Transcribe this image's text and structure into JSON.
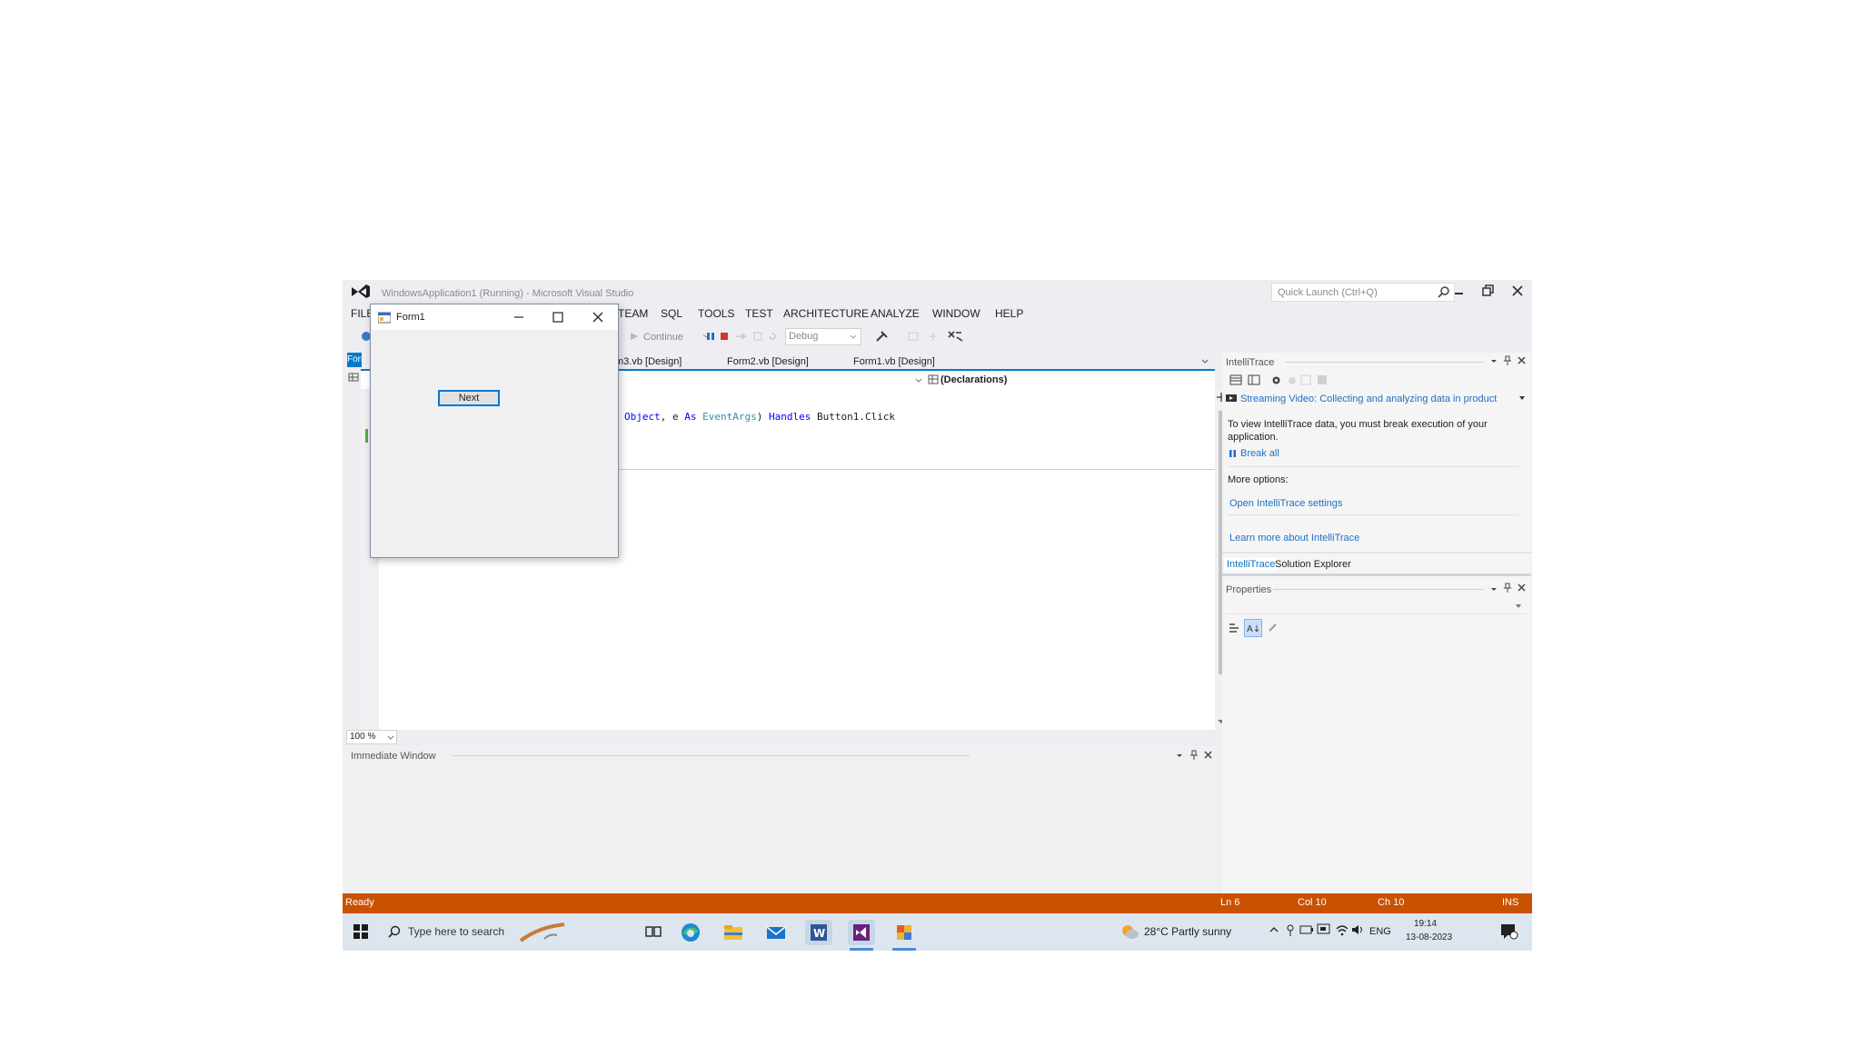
{
  "window": {
    "title": "WindowsApplication1 (Running) - Microsoft Visual Studio",
    "quick_launch_placeholder": "Quick Launch (Ctrl+Q)"
  },
  "menu": [
    "FILE",
    "TEAM",
    "SQL",
    "TOOLS",
    "TEST",
    "ARCHITECTURE",
    "ANALYZE",
    "WINDOW",
    "HELP"
  ],
  "toolbar": {
    "continue_label": "Continue",
    "config_value": "Debug"
  },
  "doc_tabs": {
    "active_partial": "Form",
    "tabs": [
      "m3.vb [Design]",
      "Form2.vb [Design]",
      "Form1.vb [Design]"
    ]
  },
  "code_nav": {
    "declarations": "(Declarations)"
  },
  "code": {
    "line": {
      "t1": "Object",
      "t2": ", e ",
      "t3": "As",
      "t4": " ",
      "t5": "EventArgs",
      "t6": ") ",
      "t7": "Handles",
      "t8": " Button1.Click"
    }
  },
  "zoom": "100 %",
  "immediate_window": {
    "title": "Immediate Window"
  },
  "form1": {
    "title": "Form1",
    "button_label": "Next"
  },
  "intellitrace": {
    "title": "IntelliTrace",
    "streaming_text": "Streaming Video: Collecting and analyzing data in product",
    "info_text": "To view IntelliTrace data, you must break execution of your application.",
    "break_all": "Break all",
    "more_options": "More options:",
    "open_settings": "Open IntelliTrace settings",
    "learn_more": "Learn more about IntelliTrace",
    "tab_intellitrace": "IntelliTrace",
    "tab_solution_explorer": "Solution Explorer"
  },
  "properties": {
    "title": "Properties"
  },
  "status": {
    "ready": "Ready",
    "ln": "Ln 6",
    "col": "Col 10",
    "ch": "Ch 10",
    "mode": "INS"
  },
  "taskbar": {
    "search_placeholder": "Type here to search",
    "weather": "28°C  Partly sunny",
    "lang": "ENG",
    "time": "19:14",
    "date": "13-08-2023"
  },
  "colors": {
    "status_bar": "#ca5100",
    "accent": "#007acc",
    "vs_purple": "#68217a"
  }
}
